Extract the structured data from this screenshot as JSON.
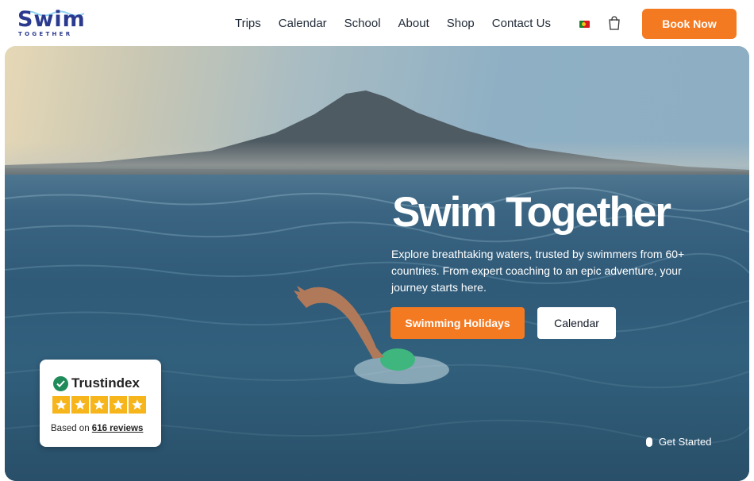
{
  "header": {
    "logo_text": "Swim",
    "logo_sub": "TOGETHER",
    "nav": [
      {
        "id": "trips",
        "label": "Trips"
      },
      {
        "id": "calendar",
        "label": "Calendar"
      },
      {
        "id": "school",
        "label": "School"
      },
      {
        "id": "about",
        "label": "About"
      },
      {
        "id": "shop",
        "label": "Shop"
      },
      {
        "id": "contact",
        "label": "Contact Us"
      }
    ],
    "language_flag": "portugal-flag-icon",
    "cart_icon": "shopping-bag-icon",
    "book_now_label": "Book Now"
  },
  "hero": {
    "title": "Swim Together",
    "description": "Explore breathtaking waters, trusted by swimmers from 60+ countries. From expert coaching to an epic adventure, your journey starts here.",
    "primary_button": "Swimming Holidays",
    "secondary_button": "Calendar",
    "scroll_cta": "Get Started",
    "scroll_icon": "mouse-icon"
  },
  "trust_widget": {
    "brand": "Trustindex",
    "rating_stars": 5,
    "based_on": "Based on ",
    "reviews_link": "616 reviews"
  },
  "colors": {
    "accent": "#f47a22",
    "logo": "#2b3a8f",
    "star": "#f7b51c",
    "trust_green": "#1f8a5a"
  }
}
